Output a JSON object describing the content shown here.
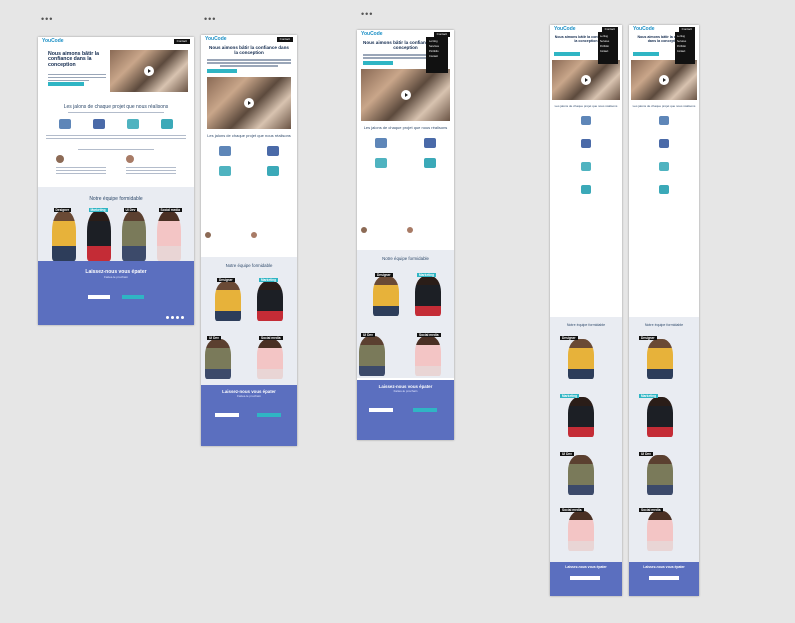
{
  "toolbar_dots": [
    "•••",
    "•••",
    "•••"
  ],
  "site": {
    "logo": "YouCode",
    "nav_button": "Contact",
    "hero_title": "Nous aimons bâtir la confiance dans la conception",
    "section_title": "Les jalons de chaque projet que nous réalisons",
    "team_title": "Notre équipe formidable",
    "footer_title": "Laissez-nous vous épater",
    "footer_sub": "Faites-le prochain",
    "team_tags": [
      "Designer",
      "Marketing",
      "UI Dev",
      "Social media"
    ],
    "menu_items": [
      "Le blog",
      "Services",
      "Portfolio",
      "Contact"
    ]
  },
  "colors": {
    "canvas": "#e6e6e6",
    "accent": "#2fb5c4",
    "navy": "#122a4e",
    "footer": "#5b6fbf"
  }
}
